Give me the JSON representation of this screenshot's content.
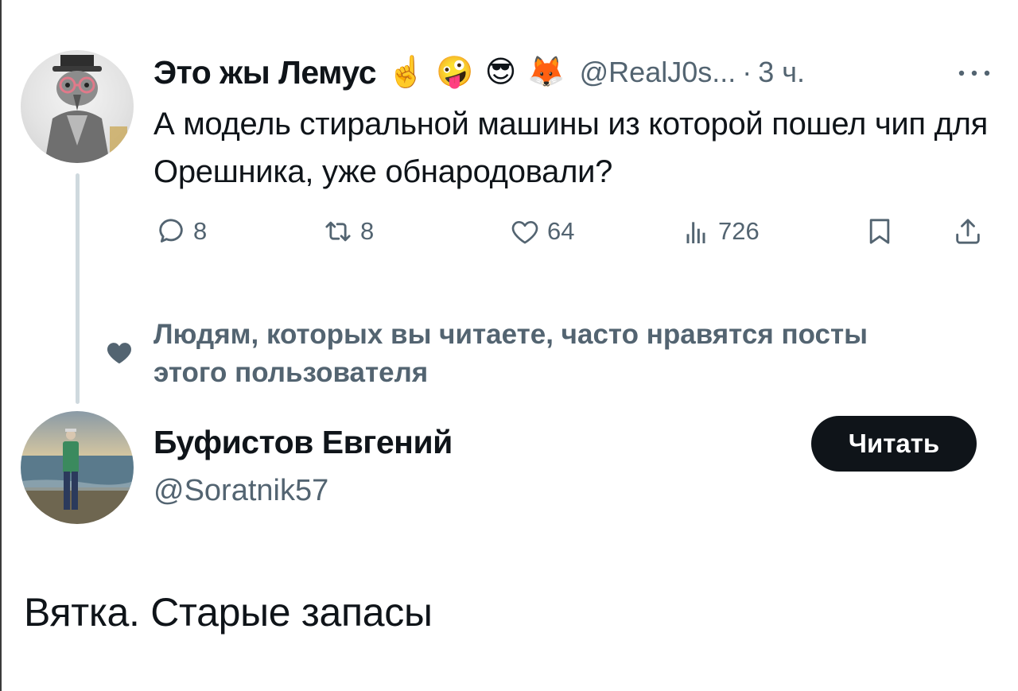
{
  "tweet": {
    "author_name": "Это жы Лемус",
    "emojis": [
      "☝️",
      "🤪",
      "😎",
      "🦊"
    ],
    "handle": "@RealJ0s...",
    "separator": "·",
    "time": "3 ч.",
    "text": "А модель стиральной машины из которой пошел чип для Орешника, уже обнародовали?",
    "actions": {
      "replies": "8",
      "reposts": "8",
      "likes": "64",
      "views": "726"
    },
    "icons": [
      "more-icon",
      "reply-icon",
      "repost-icon",
      "like-icon",
      "views-icon",
      "bookmark-icon",
      "share-icon"
    ]
  },
  "social_context": {
    "text": "Людям, которых вы читаете, часто нравятся посты этого пользователя",
    "icon": "heart-icon"
  },
  "user_card": {
    "name": "Буфистов Евгений",
    "handle": "@Soratnik57",
    "follow_label": "Читать"
  },
  "caption": "Вятка. Старые запасы",
  "colors": {
    "text": "#0f1419",
    "secondary": "#536471",
    "thread_line": "#cfd9de",
    "button_bg": "#0f1419",
    "button_text": "#ffffff"
  }
}
